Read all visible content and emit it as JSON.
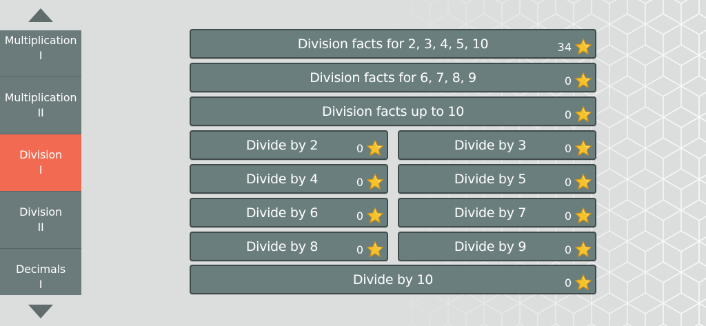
{
  "colors": {
    "button_bg": "#6b7e7e",
    "button_border": "#3f4a4a",
    "menu_bg": "#6b7a7a",
    "menu_active": "#f36a52",
    "star": "#f6c12a"
  },
  "sidebar": {
    "up_icon": "triangle-up-icon",
    "down_icon": "triangle-down-icon",
    "items": [
      {
        "line1": "Multiplication",
        "line2": "I",
        "active": false
      },
      {
        "line1": "Multiplication",
        "line2": "II",
        "active": false
      },
      {
        "line1": "Division",
        "line2": "I",
        "active": true
      },
      {
        "line1": "Division",
        "line2": "II",
        "active": false
      },
      {
        "line1": "Decimals",
        "line2": "I",
        "active": false
      }
    ]
  },
  "levels": [
    {
      "label": "Division facts for 2, 3, 4, 5, 10",
      "stars": "34"
    },
    {
      "label": "Division facts for 6, 7, 8, 9",
      "stars": "0"
    },
    {
      "label": "Division facts up to 10",
      "stars": "0"
    },
    {
      "label": "Divide by 2",
      "stars": "0"
    },
    {
      "label": "Divide by 3",
      "stars": "0"
    },
    {
      "label": "Divide by 4",
      "stars": "0"
    },
    {
      "label": "Divide by 5",
      "stars": "0"
    },
    {
      "label": "Divide by 6",
      "stars": "0"
    },
    {
      "label": "Divide by 7",
      "stars": "0"
    },
    {
      "label": "Divide by 8",
      "stars": "0"
    },
    {
      "label": "Divide by 9",
      "stars": "0"
    },
    {
      "label": "Divide by 10",
      "stars": "0"
    }
  ]
}
